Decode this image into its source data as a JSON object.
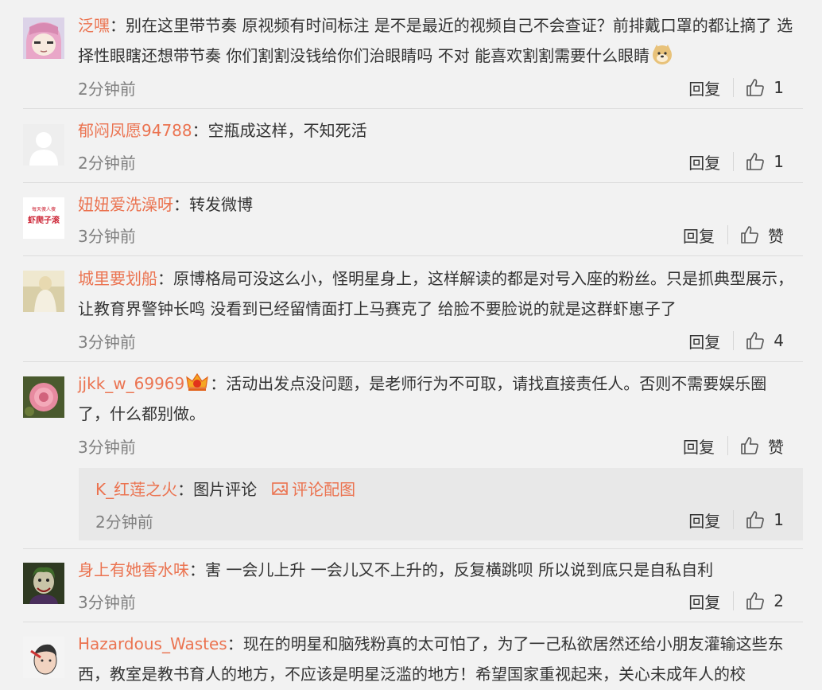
{
  "comments": [
    {
      "username": "泛嘿",
      "text": "别在这里带节奏 原视频有时间标注 是不是最近的视频自己不会查证？前排戴口罩的都让摘了 选择性眼瞎还想带节奏 你们割割没钱给你们治眼睛吗 不对 能喜欢割割需要什么眼睛",
      "time": "2分钟前",
      "reply_label": "回复",
      "likes": "1"
    },
    {
      "username": "郁闷凤愿94788",
      "text": "空瓶成这样，不知死活",
      "time": "2分钟前",
      "reply_label": "回复",
      "likes": "1"
    },
    {
      "username": "妞妞爱洗澡呀",
      "text": "转发微博",
      "time": "3分钟前",
      "reply_label": "回复",
      "likes": "赞",
      "avatar_text_top": "每天傻人傻",
      "avatar_text_main": "虾爬子滚"
    },
    {
      "username": "城里要划船",
      "text": "原博格局可没这么小，怪明星身上，这样解读的都是对号入座的粉丝。只是抓典型展示，让教育界警钟长鸣 没看到已经留情面打上马赛克了  给脸不要脸说的就是这群虾崽子了",
      "time": "3分钟前",
      "reply_label": "回复",
      "likes": "4"
    },
    {
      "username": "jjkk_w_69969",
      "text": "活动出发点没问题，是老师行为不可取，请找直接责任人。否则不需要娱乐圈了，什么都别做。",
      "time": "3分钟前",
      "reply_label": "回复",
      "likes": "赞"
    },
    {
      "username": "身上有她香水味",
      "text": "害 一会儿上升 一会儿又不上升的，反复横跳呗  所以说到底只是自私自利",
      "time": "3分钟前",
      "reply_label": "回复",
      "likes": "2"
    },
    {
      "username": "Hazardous_Wastes",
      "text": "现在的明星和脑残粉真的太可怕了，为了一己私欲居然还给小朋友灌输这些东西，教室是教书育人的地方，不应该是明星泛滥的地方！希望国家重视起来，关心未成年人的校"
    }
  ],
  "sub_reply": {
    "username": "K_红莲之火",
    "text": "图片评论",
    "pic_link": "评论配图",
    "time": "2分钟前",
    "reply_label": "回复",
    "likes": "1"
  },
  "colon": "：",
  "colors": {
    "username": "#eb7350",
    "time": "#808080",
    "background": "#f2f2f2",
    "sub_reply_bg": "#e8e8e8"
  },
  "icons": [
    "thumbs-up-icon",
    "image-icon",
    "doge-emoji",
    "vip-crown-badge"
  ]
}
